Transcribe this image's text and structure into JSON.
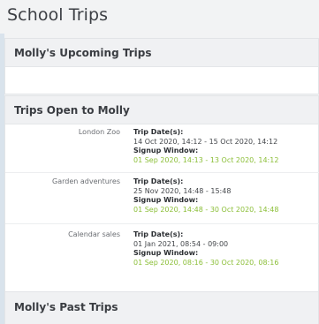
{
  "page": {
    "title": "School Trips"
  },
  "sections": {
    "upcoming": {
      "header": "Molly's Upcoming Trips"
    },
    "open": {
      "header": "Trips Open to Molly",
      "trip_date_label": "Trip Date(s):",
      "signup_label": "Signup Window:",
      "trips": [
        {
          "name": "London Zoo",
          "dates": "14 Oct 2020, 14:12 - 15 Oct 2020, 14:12",
          "signup": "01 Sep 2020, 14:13 - 13 Oct 2020, 14:12"
        },
        {
          "name": "Garden adventures",
          "dates": "25 Nov 2020, 14:48 - 15:48",
          "signup": "01 Sep 2020, 14:48 - 30 Oct 2020, 14:48"
        },
        {
          "name": "Calendar sales",
          "dates": "01 Jan 2021, 08:54 - 09:00",
          "signup": "01 Sep 2020, 08:16 - 30 Oct 2020, 08:16"
        }
      ]
    },
    "past": {
      "header": "Molly's Past Trips"
    }
  },
  "colors": {
    "signup_window_text": "#8cbf39",
    "panel_header_bg": "#f0f1f3"
  }
}
